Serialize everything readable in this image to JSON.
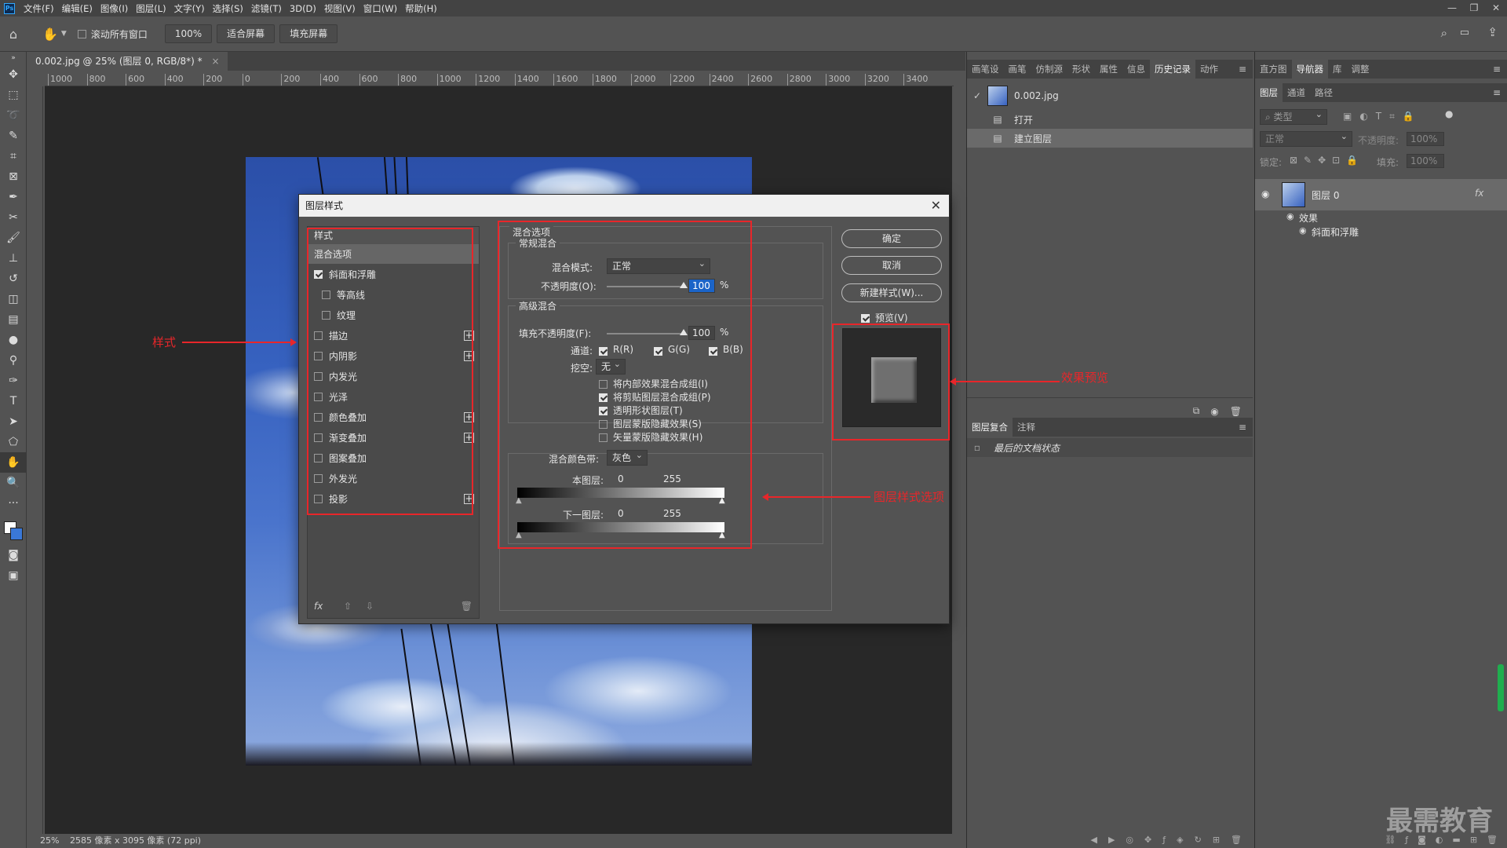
{
  "menubar": {
    "logo": "Ps",
    "items": [
      "文件(F)",
      "编辑(E)",
      "图像(I)",
      "图层(L)",
      "文字(Y)",
      "选择(S)",
      "滤镜(T)",
      "3D(D)",
      "视图(V)",
      "窗口(W)",
      "帮助(H)"
    ],
    "minimize": "—",
    "restore": "❐",
    "close": "✕"
  },
  "options": {
    "scroll_all": "滚动所有窗口",
    "zoom": "100%",
    "fit_screen": "适合屏幕",
    "fill_screen": "填充屏幕"
  },
  "document": {
    "tab_title": "0.002.jpg @ 25% (图层 0, RGB/8*) *",
    "tab_close": "×",
    "ruler_ticks": [
      "1000",
      "800",
      "600",
      "400",
      "200",
      "0",
      "200",
      "400",
      "600",
      "800",
      "1000",
      "1200",
      "1400",
      "1600",
      "1800",
      "2000",
      "2200",
      "2400",
      "2600",
      "2800",
      "3000",
      "3200",
      "3400"
    ],
    "status_zoom": "25%",
    "status_info": "2585 像素 x 3095 像素 (72 ppi)"
  },
  "history_panel": {
    "tabs": [
      "画笔设",
      "画笔",
      "仿制源",
      "形状",
      "属性",
      "信息",
      "历史记录",
      "动作"
    ],
    "active_tab": "历史记录",
    "snapshot": "0.002.jpg",
    "steps": [
      "打开",
      "建立图层"
    ],
    "selected_step": "建立图层"
  },
  "comps_panel": {
    "tabs": [
      "图层复合",
      "注释"
    ],
    "row": "最后的文档状态"
  },
  "right_panel": {
    "top_tabs": [
      "直方图",
      "导航器",
      "库",
      "调整"
    ],
    "active_top": "导航器",
    "layer_tabs": [
      "图层",
      "通道",
      "路径"
    ],
    "filter_kind": "类型",
    "blend_mode": "正常",
    "opacity_label": "不透明度:",
    "opacity": "100%",
    "lock_label": "锁定:",
    "fill_label": "填充:",
    "fill": "100%",
    "layer_name": "图层 0",
    "fx": "fx",
    "effects": "效果",
    "effect_item": "斜面和浮雕"
  },
  "dialog": {
    "title": "图层样式",
    "close": "✕",
    "styles_header": "样式",
    "styles": [
      {
        "label": "混合选项",
        "checkbox": false,
        "checked": false,
        "plus": false,
        "indent": false,
        "selected": true
      },
      {
        "label": "斜面和浮雕",
        "checkbox": true,
        "checked": true,
        "plus": false,
        "indent": false
      },
      {
        "label": "等高线",
        "checkbox": true,
        "checked": false,
        "plus": false,
        "indent": true
      },
      {
        "label": "纹理",
        "checkbox": true,
        "checked": false,
        "plus": false,
        "indent": true
      },
      {
        "label": "描边",
        "checkbox": true,
        "checked": false,
        "plus": true,
        "indent": false
      },
      {
        "label": "内阴影",
        "checkbox": true,
        "checked": false,
        "plus": true,
        "indent": false
      },
      {
        "label": "内发光",
        "checkbox": true,
        "checked": false,
        "plus": false,
        "indent": false
      },
      {
        "label": "光泽",
        "checkbox": true,
        "checked": false,
        "plus": false,
        "indent": false
      },
      {
        "label": "颜色叠加",
        "checkbox": true,
        "checked": false,
        "plus": true,
        "indent": false
      },
      {
        "label": "渐变叠加",
        "checkbox": true,
        "checked": false,
        "plus": true,
        "indent": false
      },
      {
        "label": "图案叠加",
        "checkbox": true,
        "checked": false,
        "plus": false,
        "indent": false
      },
      {
        "label": "外发光",
        "checkbox": true,
        "checked": false,
        "plus": false,
        "indent": false
      },
      {
        "label": "投影",
        "checkbox": true,
        "checked": false,
        "plus": true,
        "indent": false
      }
    ],
    "fx_label": "fx",
    "blend": {
      "section": "混合选项",
      "general": "常规混合",
      "mode_label": "混合模式:",
      "mode": "正常",
      "opacity_label": "不透明度(O):",
      "opacity": "100",
      "opacity_level": 1.0,
      "pct": "%",
      "advanced": "高级混合",
      "fill_label": "填充不透明度(F):",
      "fill": "100",
      "fill_level": 1.0,
      "channels_label": "通道:",
      "ch_r": "R(R)",
      "ch_g": "G(G)",
      "ch_b": "B(B)",
      "knockout_label": "挖空:",
      "knockout": "无",
      "opt1": "将内部效果混合成组(I)",
      "opt2": "将剪贴图层混合成组(P)",
      "opt3": "透明形状图层(T)",
      "opt4": "图层蒙版隐藏效果(S)",
      "opt5": "矢量蒙版隐藏效果(H)",
      "band_label": "混合颜色带:",
      "band": "灰色",
      "this_layer": "本图层:",
      "under_layer": "下一图层:",
      "min": "0",
      "max": "255"
    },
    "ok": "确定",
    "cancel": "取消",
    "new_style": "新建样式(W)...",
    "preview": "预览(V)"
  },
  "annotations": {
    "styles": "样式",
    "preview": "效果预览",
    "options": "图层样式选项"
  },
  "watermark": "最需教育",
  "colors": {
    "annotation": "#e8262a",
    "panel": "#535353",
    "canvas": "#282828"
  }
}
